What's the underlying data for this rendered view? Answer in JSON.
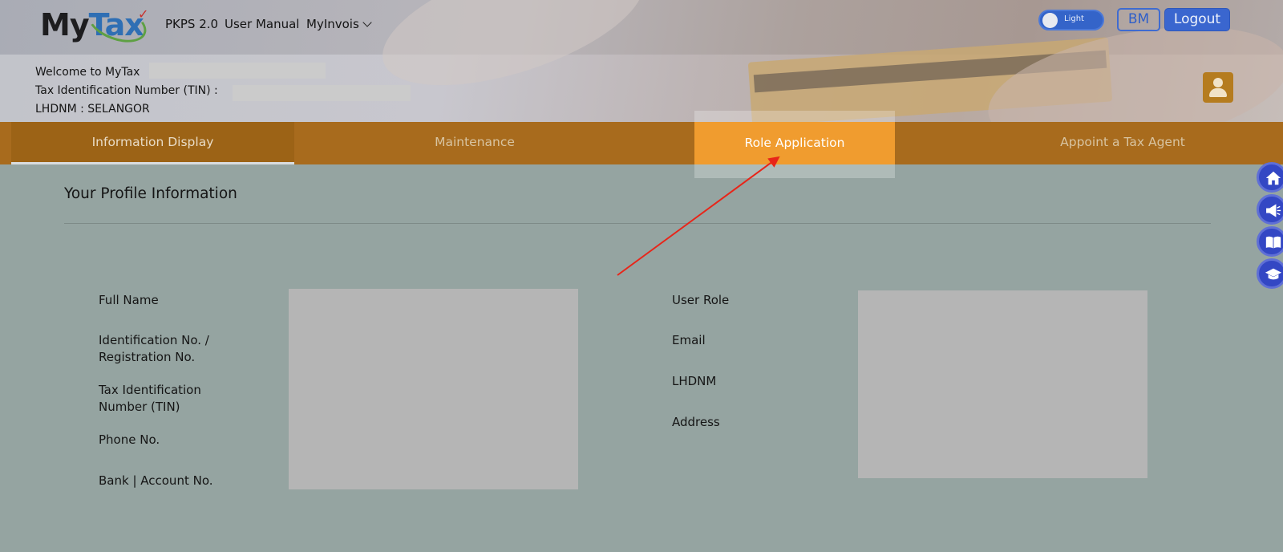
{
  "header": {
    "logo_my": "My",
    "logo_tax": "Tax",
    "nav": [
      {
        "label": "PKPS 2.0"
      },
      {
        "label": "User Manual"
      },
      {
        "label": "MyInvois"
      }
    ],
    "theme_toggle_label": "Light",
    "language_button": "BM",
    "logout_button": "Logout",
    "welcome_text": "Welcome to MyTax",
    "tin_label": "Tax Identification Number (TIN) :",
    "lhdnm_line": "LHDNM : SELANGOR"
  },
  "tabs": [
    {
      "label": "Information Display",
      "active": true
    },
    {
      "label": "Maintenance"
    },
    {
      "label": "Role Application",
      "highlighted": true
    },
    {
      "label": "Appoint a Tax Agent"
    }
  ],
  "main": {
    "section_title": "Your Profile Information",
    "left_labels": {
      "full_name": "Full Name",
      "id_no_1": "Identification No. /",
      "id_no_2": "Registration No.",
      "tin_1": "Tax Identification",
      "tin_2": "Number (TIN)",
      "phone": "Phone No.",
      "bank": "Bank | Account No."
    },
    "right_labels": {
      "user_role": "User Role",
      "email": "Email",
      "lhdnm": "LHDNM",
      "address": "Address"
    }
  },
  "side_buttons": [
    {
      "icon": "home-icon"
    },
    {
      "icon": "megaphone-icon"
    },
    {
      "icon": "book-icon"
    },
    {
      "icon": "graduation-cap-icon"
    }
  ],
  "colors": {
    "tab_bar": "#a86b1d",
    "tab_highlight": "#f09c2f",
    "primary_blue": "#3a66cf",
    "annotation_arrow": "#e82519"
  }
}
